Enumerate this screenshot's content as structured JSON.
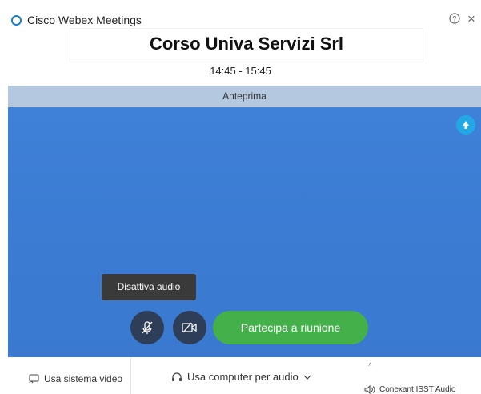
{
  "app": {
    "title": "Cisco Webex Meetings"
  },
  "meeting": {
    "title": "Corso Univa Servizi Srl",
    "time": "14:45 - 15:45"
  },
  "preview": {
    "label": "Anteprima"
  },
  "tooltip": {
    "text": "Disattiva audio"
  },
  "controls": {
    "join_label": "Partecipa a riunione"
  },
  "bottom": {
    "video_system": "Usa sistema video",
    "audio_option": "Usa computer per audio",
    "speaker": "Conexant ISST Audio"
  },
  "colors": {
    "video_bg": "#3e7fd6",
    "join": "#43b04a",
    "control": "#2e3e58",
    "accent": "#1d7fc7"
  },
  "icons": [
    "webex-logo-icon",
    "help-icon",
    "close-icon",
    "background-icon",
    "mic-muted-icon",
    "camera-off-icon",
    "cast-icon",
    "headset-icon",
    "chevron-down-icon",
    "speaker-icon"
  ]
}
